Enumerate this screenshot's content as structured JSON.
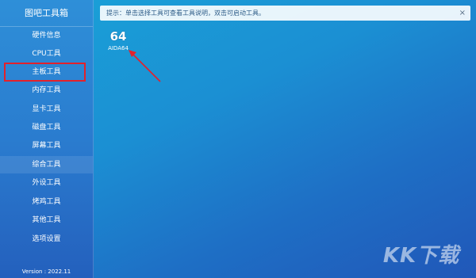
{
  "app": {
    "title": "图吧工具箱",
    "version": "Version : 2022.11"
  },
  "sidebar": {
    "items": [
      {
        "label": "硬件信息"
      },
      {
        "label": "CPU工具"
      },
      {
        "label": "主板工具"
      },
      {
        "label": "内存工具"
      },
      {
        "label": "显卡工具"
      },
      {
        "label": "磁盘工具"
      },
      {
        "label": "屏幕工具"
      },
      {
        "label": "综合工具"
      },
      {
        "label": "外设工具"
      },
      {
        "label": "烤鸡工具"
      },
      {
        "label": "其他工具"
      },
      {
        "label": "选项设置"
      }
    ],
    "active_item": "综合工具",
    "highlighted_item": "主板工具"
  },
  "hint": {
    "text": "提示：单击选择工具可查看工具说明，双击可启动工具。",
    "close_glyph": "×"
  },
  "tools": [
    {
      "icon_text": "64",
      "label": "AIDA64"
    }
  ],
  "watermark": {
    "text": "KK下载"
  },
  "colors": {
    "highlight_border": "#e3212b",
    "arrow": "#e3212b",
    "background_accent": "#1b8fd3"
  }
}
